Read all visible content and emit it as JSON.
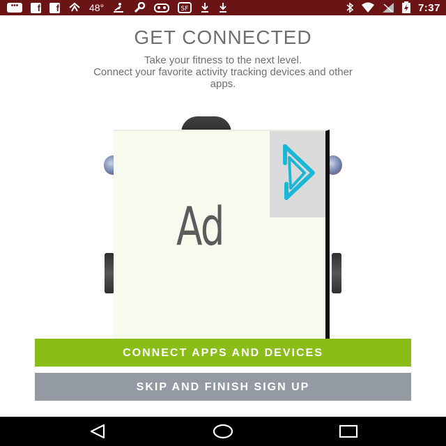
{
  "status_bar": {
    "icons_left": [
      "message-icon",
      "facebook-icon",
      "facebook-icon",
      "location-icon",
      "rowing-icon",
      "wrench-icon",
      "gamepad-icon",
      "app-icon",
      "download-icon",
      "download-icon"
    ],
    "temperature": "48°",
    "icons_right": [
      "bluetooth-icon",
      "wifi-icon",
      "signal-icon",
      "battery-icon"
    ],
    "time": "7:37"
  },
  "header": {
    "title": "GET CONNECTED",
    "subtitle_line1": "Take your fitness to the next level.",
    "subtitle_line2": "Connect your favorite activity tracking devices and other",
    "subtitle_line3": "apps."
  },
  "ad": {
    "label": "Ad",
    "icon": "play-icon"
  },
  "actions": {
    "connect_label": "CONNECT APPS AND DEVICES",
    "skip_label": "SKIP AND FINISH SIGN UP"
  },
  "nav_bar": {
    "back_icon": "back-icon",
    "home_icon": "home-icon",
    "recent_icon": "recent-apps-icon"
  },
  "colors": {
    "status_bar": "#6b1416",
    "primary_button": "#8bbd18",
    "secondary_button": "#949aa3",
    "title_text": "#6f6f6f"
  }
}
